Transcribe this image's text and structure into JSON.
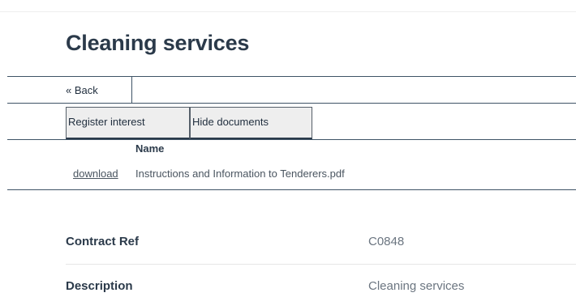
{
  "page": {
    "title": "Cleaning services"
  },
  "nav": {
    "back_label": "« Back"
  },
  "actions": {
    "register_label": "Register interest",
    "hide_documents_label": "Hide documents"
  },
  "documents": {
    "column_header": "Name",
    "items": [
      {
        "action_label": "download",
        "name": "Instructions and Information to Tenderers.pdf"
      }
    ]
  },
  "details": [
    {
      "label": "Contract Ref",
      "value": "C0848"
    },
    {
      "label": "Description",
      "value": "Cleaning services"
    }
  ]
}
